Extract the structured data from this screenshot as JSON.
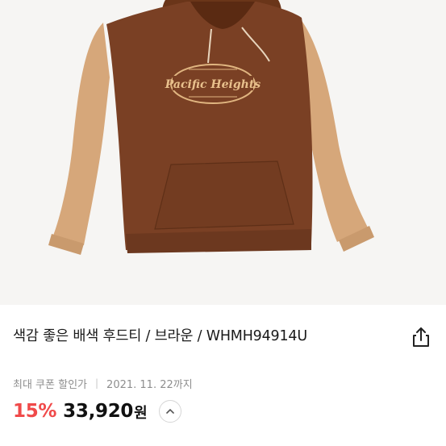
{
  "product": {
    "image_alt": "brown hoodie with beige sleeves",
    "graphic_text": "Pacific Heights",
    "title": "색감 좋은 배색 후드티 / 브라운 / WHMH94914U",
    "colors": {
      "body": "#7a4024",
      "sleeve": "#d6a77a",
      "background": "#f6f5f3",
      "print": "#e0b580"
    }
  },
  "coupon": {
    "label": "최대 쿠폰 할인가",
    "separator": "|",
    "date": "2021. 11. 22까지"
  },
  "price": {
    "discount": "15%",
    "amount": "33,920",
    "currency": "원",
    "discount_color": "#f04a4a"
  },
  "icons": {
    "share": "share-icon",
    "expand": "chevron-up-icon"
  }
}
